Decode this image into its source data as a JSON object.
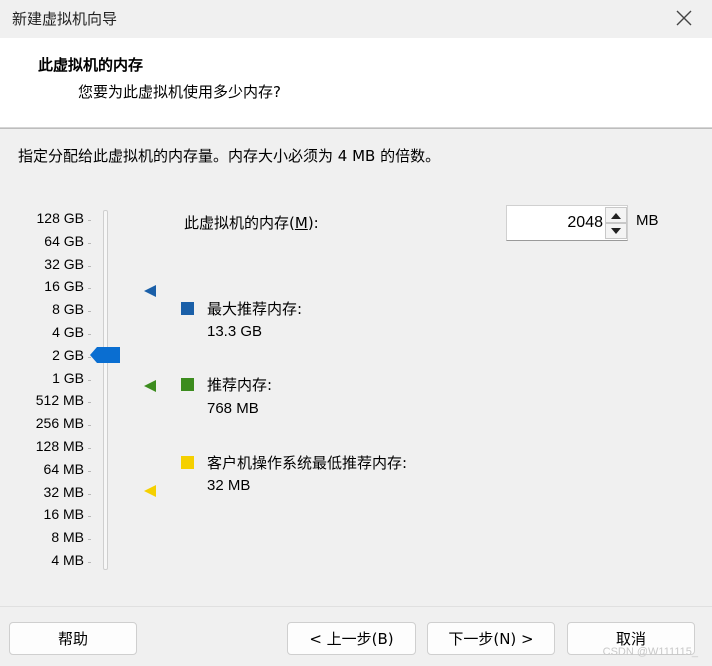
{
  "window": {
    "title": "新建虚拟机向导"
  },
  "header": {
    "title": "此虚拟机的内存",
    "subtitle": "您要为此虚拟机使用多少内存?"
  },
  "instruction": "指定分配给此虚拟机的内存量。内存大小必须为 4 MB 的倍数。",
  "memory": {
    "label_prefix": "此虚拟机的内存(",
    "label_mnemonic": "M",
    "label_suffix": "):",
    "value": "2048",
    "unit": "MB"
  },
  "scale_labels": [
    "128 GB",
    "64 GB",
    "32 GB",
    "16 GB",
    "8 GB",
    "4 GB",
    "2 GB",
    "1 GB",
    "512 MB",
    "256 MB",
    "128 MB",
    "64 MB",
    "32 MB",
    "16 MB",
    "8 MB",
    "4 MB"
  ],
  "slider": {
    "current_label": "2 GB",
    "thumb_color": "#0a6ed1"
  },
  "legend": {
    "max": {
      "title": "最大推荐内存:",
      "value": "13.3 GB",
      "color": "#1a5fa8"
    },
    "recommended": {
      "title": "推荐内存:",
      "value": "768 MB",
      "color": "#3c8c1e"
    },
    "min": {
      "title": "客户机操作系统最低推荐内存:",
      "value": "32 MB",
      "color": "#f5d000"
    }
  },
  "buttons": {
    "help": "帮助",
    "back": "< 上一步(B)",
    "next": "下一步(N) >",
    "cancel": "取消"
  },
  "watermark": "CSDN @W111115_"
}
